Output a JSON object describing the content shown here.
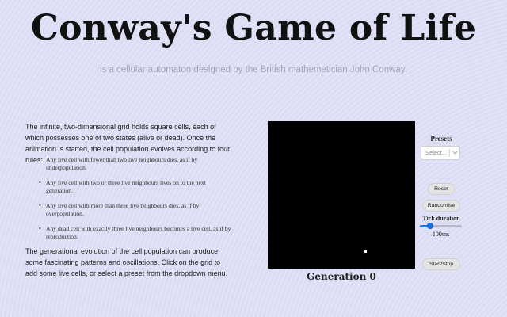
{
  "header": {
    "title": "Conway's Game of Life",
    "subtitle": "is a cellular automaton designed by the British mathemetician John Conway."
  },
  "description": {
    "intro": "The infinite, two-dimensional grid holds square cells, each of which possesses one of two states (alive or dead). Once the animation is started, the cell population evolves according to four rules:",
    "rules": [
      "Any live cell with fewer than two live neighbours dies, as if by underpopulation.",
      "Any live cell with two or three live neighbours lives on to the next generation.",
      "Any live cell with more than three live neighbours dies, as if by overpopulation.",
      "Any dead cell with exactly three live neighbours becomes a live cell, as if by reproduction."
    ],
    "outro": "The generational evolution of the cell population can produce some fascinating patterns and oscillations. Click on the grid to add some live cells, or select a preset from the dropdown menu."
  },
  "board": {
    "generation_label": "Generation 0",
    "colors": {
      "background": "#000000",
      "live_cell": "#ffffff"
    }
  },
  "controls": {
    "presets_label": "Presets",
    "presets_placeholder": "Select...",
    "reset_label": "Reset",
    "randomise_label": "Randomise",
    "tick_label": "Tick duration",
    "tick_value": "100ms",
    "tick_slider_fraction": 0.25,
    "start_stop_label": "Start/Stop",
    "accent_color": "#1a73e8"
  }
}
